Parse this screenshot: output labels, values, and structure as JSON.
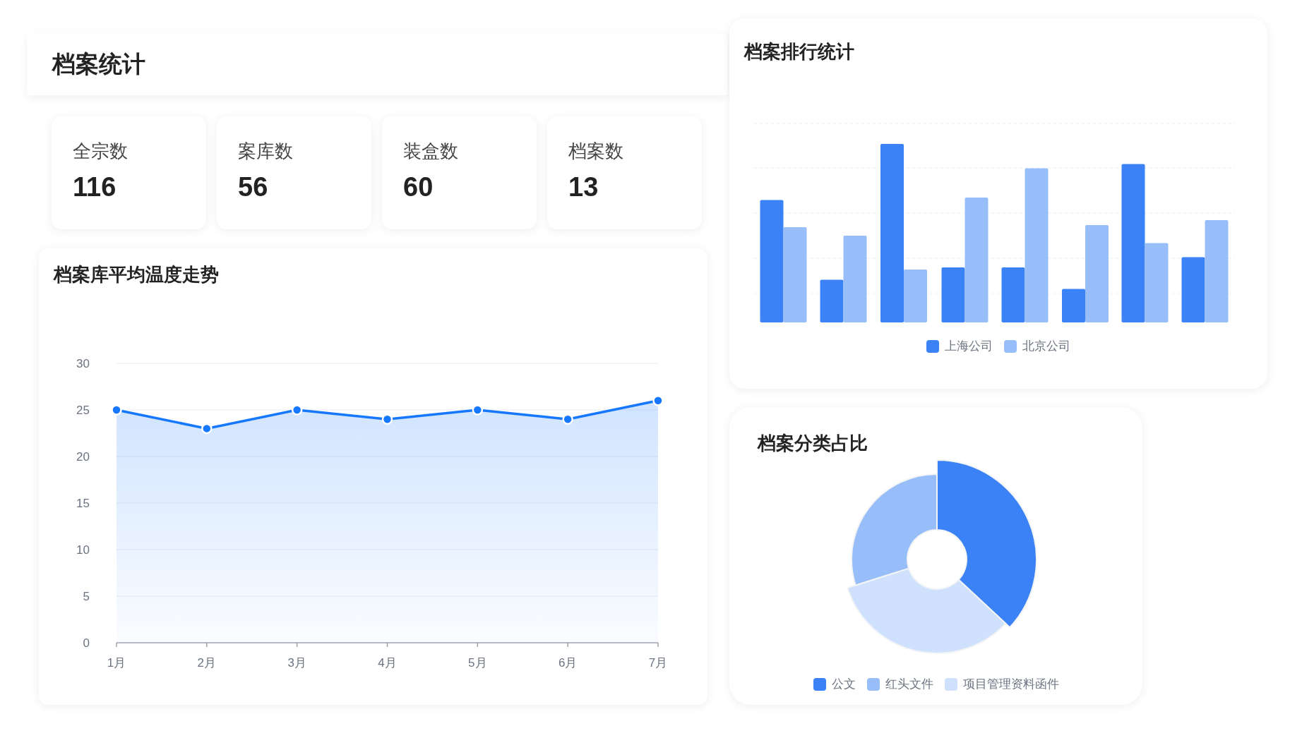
{
  "header": {
    "title": "档案统计"
  },
  "stats": [
    {
      "label": "全宗数",
      "value": "116"
    },
    {
      "label": "案库数",
      "value": "56"
    },
    {
      "label": "装盒数",
      "value": "60"
    },
    {
      "label": "档案数",
      "value": "13"
    }
  ],
  "temperature_card": {
    "title": "档案库平均温度走势",
    "chart_data": {
      "type": "area",
      "categories": [
        "1月",
        "2月",
        "3月",
        "4月",
        "5月",
        "6月",
        "7月"
      ],
      "series": [
        {
          "color": "#1677ff",
          "values": [
            25,
            23,
            25,
            24,
            25,
            24,
            26
          ]
        }
      ],
      "grid": true,
      "ylim": [
        0,
        30
      ],
      "yticks": [
        0,
        5,
        10,
        15,
        20,
        25,
        30
      ]
    }
  },
  "ranking_card": {
    "title": "档案排行统计",
    "legend": [
      {
        "label": "上海公司",
        "color": "#3b82f6"
      },
      {
        "label": "北京公司",
        "color": "#97bef9"
      }
    ]
  },
  "category_card": {
    "title": "档案分类占比",
    "legend": [
      {
        "label": "公文",
        "color": "#3b82f6"
      },
      {
        "label": "红头文件",
        "color": "#97bef9"
      },
      {
        "label": "项目管理资料函件",
        "color": "#cfe1fd"
      }
    ]
  }
}
